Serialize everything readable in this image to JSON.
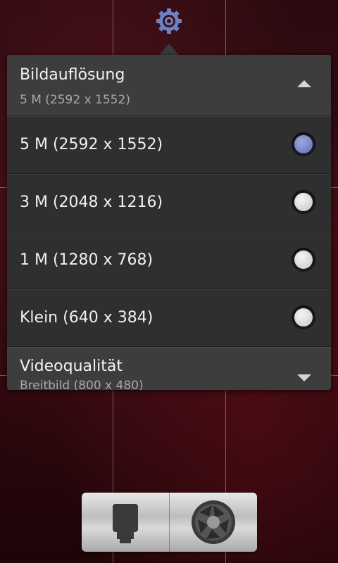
{
  "settings": {
    "icon": "gear-icon",
    "accent_color": "#5c6fb0"
  },
  "popup": {
    "resolution": {
      "title": "Bildauflösung",
      "current": "5 M (2592 x 1552)",
      "options": [
        {
          "label": "5 M (2592 x 1552)",
          "selected": true
        },
        {
          "label": "3 M (2048 x 1216)",
          "selected": false
        },
        {
          "label": "1 M (1280 x 768)",
          "selected": false
        },
        {
          "label": "Klein (640 x 384)",
          "selected": false
        }
      ]
    },
    "video": {
      "title": "Videoqualität",
      "current": "Breitbild (800 x 480)"
    }
  },
  "controls": {
    "camera_switch_icon": "camera-switch-icon",
    "shutter_icon": "shutter-icon"
  }
}
